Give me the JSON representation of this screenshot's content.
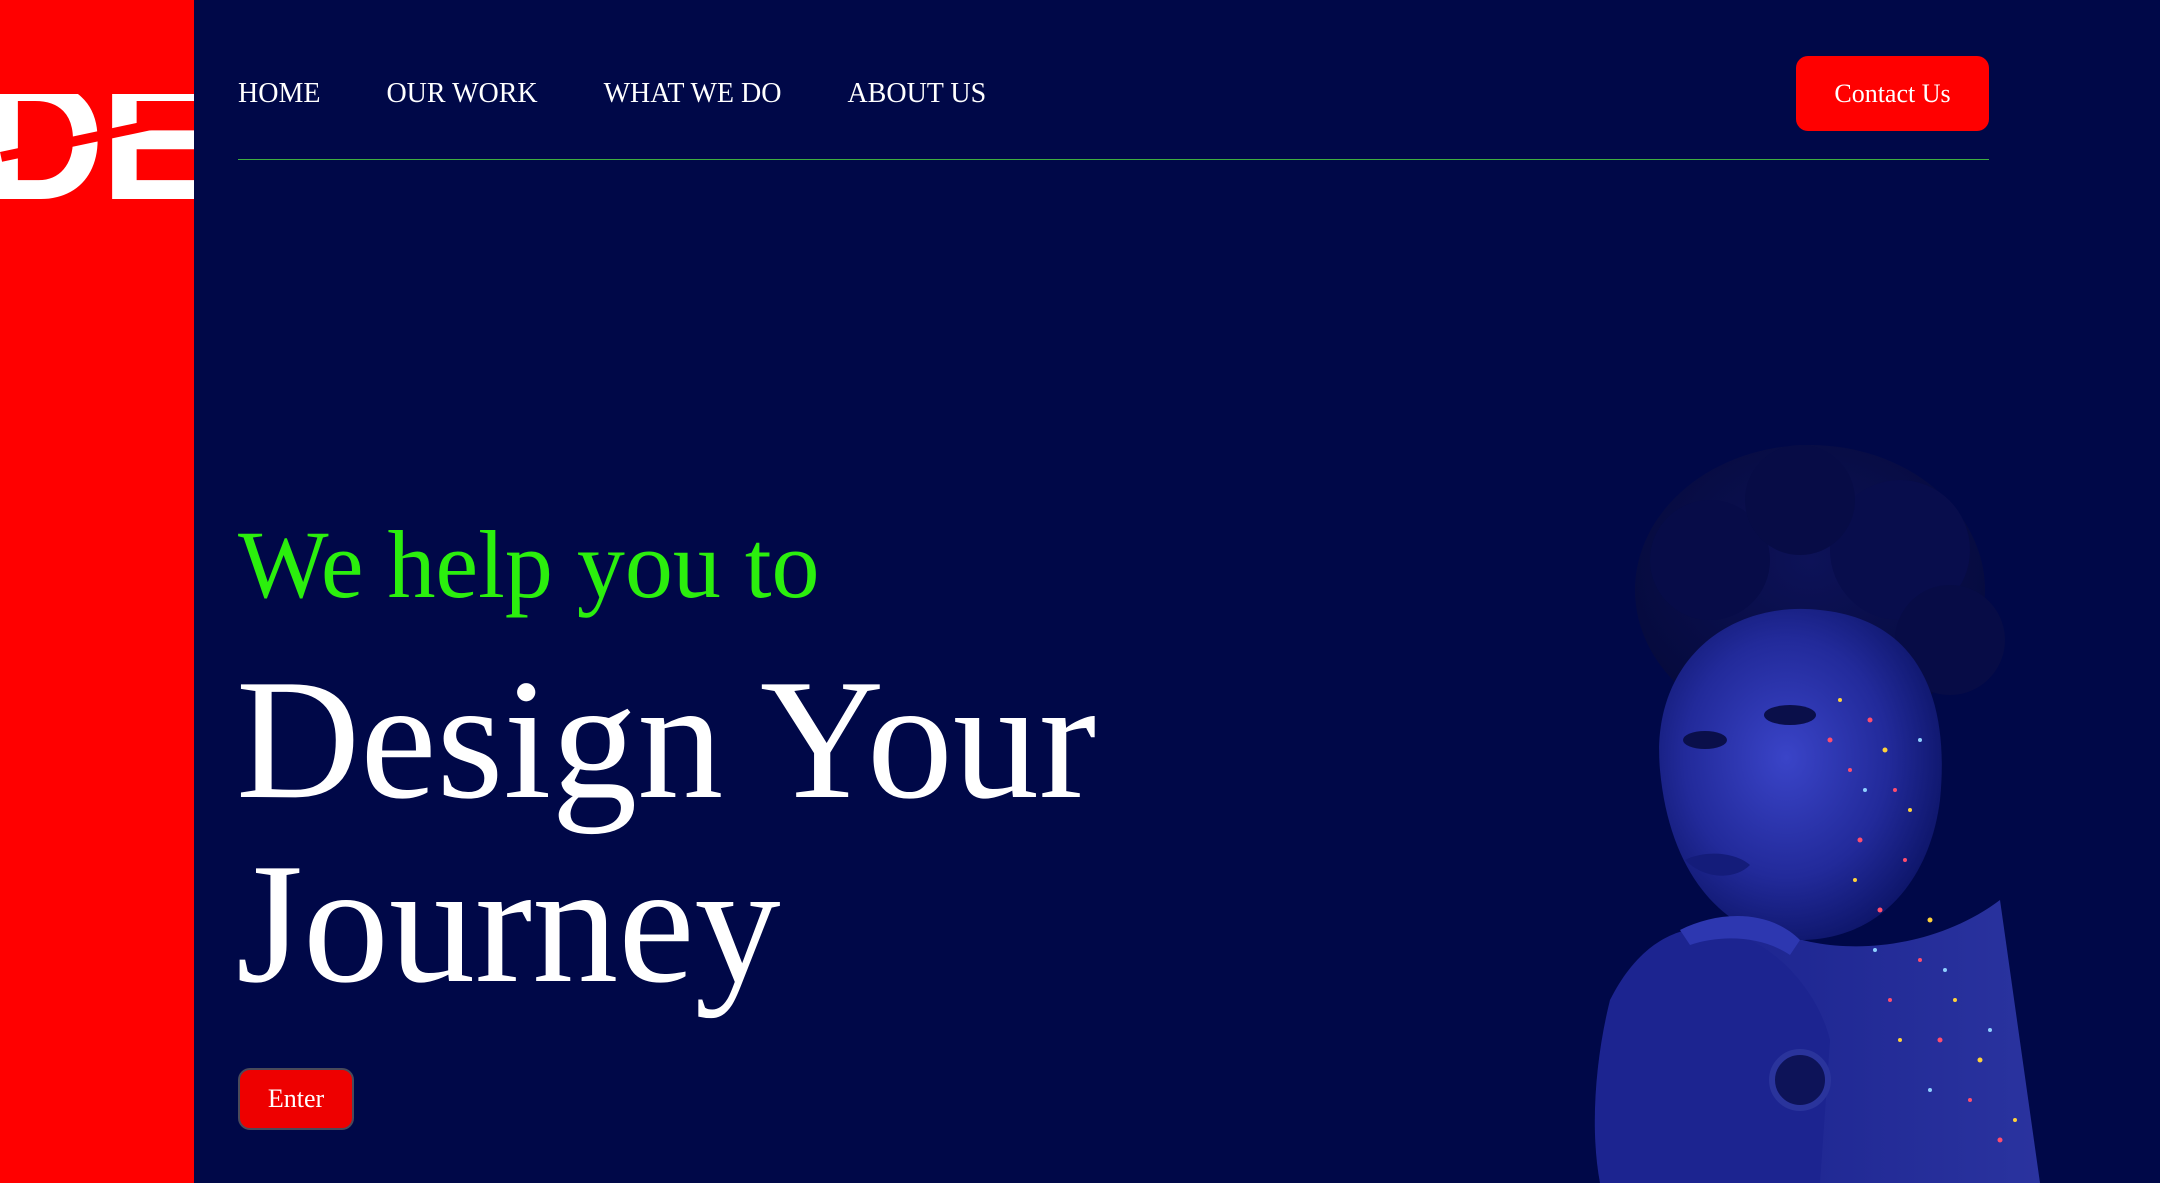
{
  "brand": {
    "logo_text": "DE",
    "sidebar_color": "#ff0000"
  },
  "nav": {
    "items": [
      {
        "label": "HOME"
      },
      {
        "label": "OUR WORK"
      },
      {
        "label": "WHAT WE DO"
      },
      {
        "label": "ABOUT US"
      }
    ],
    "contact_label": "Contact Us"
  },
  "hero": {
    "subtitle": "We help you to",
    "title": "Design Your Journey",
    "enter_label": "Enter",
    "image_icon": "portrait-photo"
  },
  "colors": {
    "background": "#000848",
    "accent_red": "#ff0000",
    "accent_green": "#2bef0d",
    "text": "#ffffff"
  }
}
